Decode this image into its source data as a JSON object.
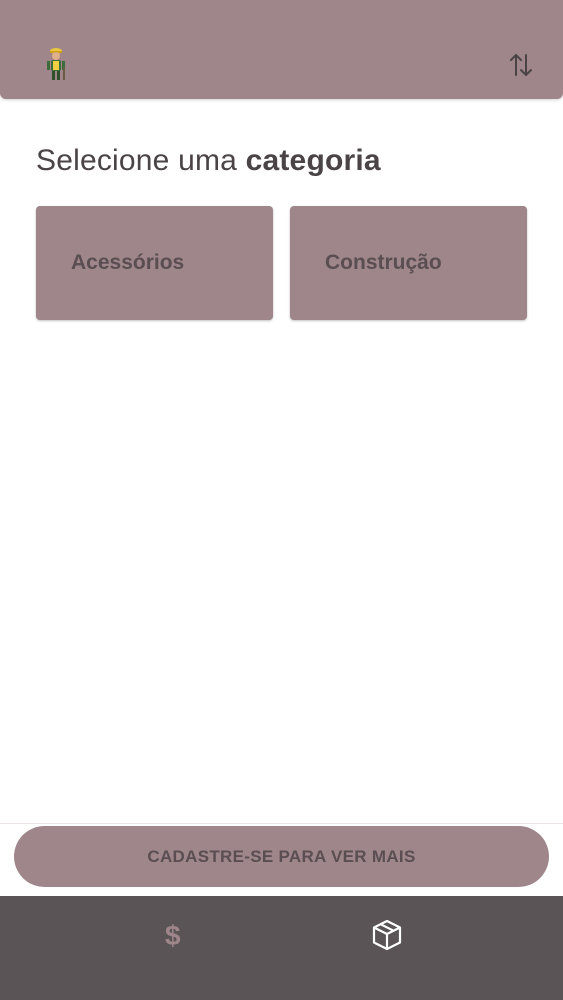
{
  "header": {
    "logo_icon": "construction-worker-icon",
    "sort_icon": "sort-arrows-icon"
  },
  "main": {
    "heading_prefix": "Selecione uma ",
    "heading_bold": "categoria",
    "categories": [
      {
        "label": "Acessórios"
      },
      {
        "label": "Construção"
      }
    ]
  },
  "cta": {
    "label": "CADASTRE-SE PARA VER MAIS"
  },
  "bottom_nav": {
    "items": [
      {
        "icon": "dollar-icon",
        "glyph": "$",
        "active": false
      },
      {
        "icon": "box-icon",
        "active": true
      }
    ]
  },
  "colors": {
    "brand": "#9e868a",
    "nav_background": "#5b5456",
    "text_dark": "#4a4447",
    "card_text": "#5a4e52"
  }
}
